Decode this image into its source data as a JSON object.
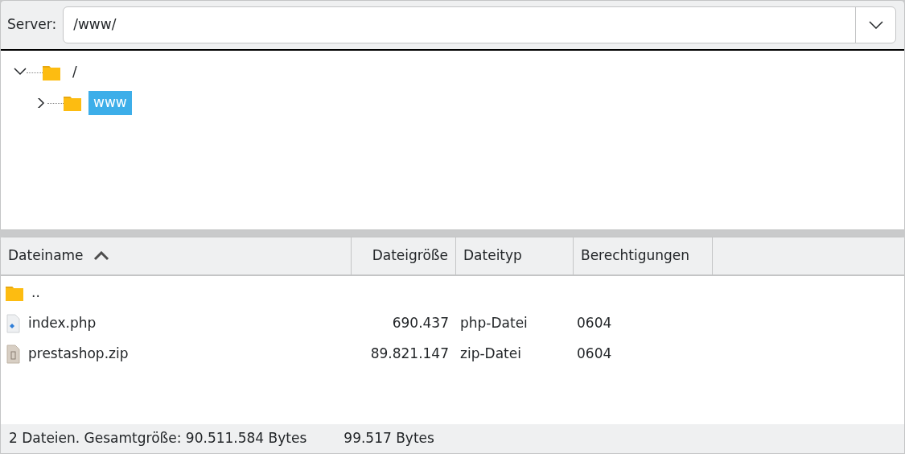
{
  "server_bar": {
    "label": "Server:",
    "path": "/www/"
  },
  "tree": [
    {
      "label": "/",
      "expanded": true,
      "selected": false,
      "children": [
        {
          "label": "www",
          "expanded": false,
          "selected": true
        }
      ]
    }
  ],
  "table": {
    "columns": [
      {
        "label": "Dateiname",
        "sorted": true
      },
      {
        "label": "Dateigröße",
        "sorted": false
      },
      {
        "label": "Dateityp",
        "sorted": false
      },
      {
        "label": "Berechtigungen",
        "sorted": false
      }
    ],
    "rows": [
      {
        "kind": "folder",
        "name": "..",
        "size": "",
        "type": "",
        "permissions": ""
      },
      {
        "kind": "php",
        "name": "index.php",
        "size": "690.437",
        "type": "php-Datei",
        "permissions": "0604"
      },
      {
        "kind": "zip",
        "name": "prestashop.zip",
        "size": "89.821.147",
        "type": "zip-Datei",
        "permissions": "0604"
      }
    ]
  },
  "status_bar": {
    "summary": "2 Dateien. Gesamtgröße: 90.511.584 Bytes",
    "free": "99.517 Bytes"
  }
}
